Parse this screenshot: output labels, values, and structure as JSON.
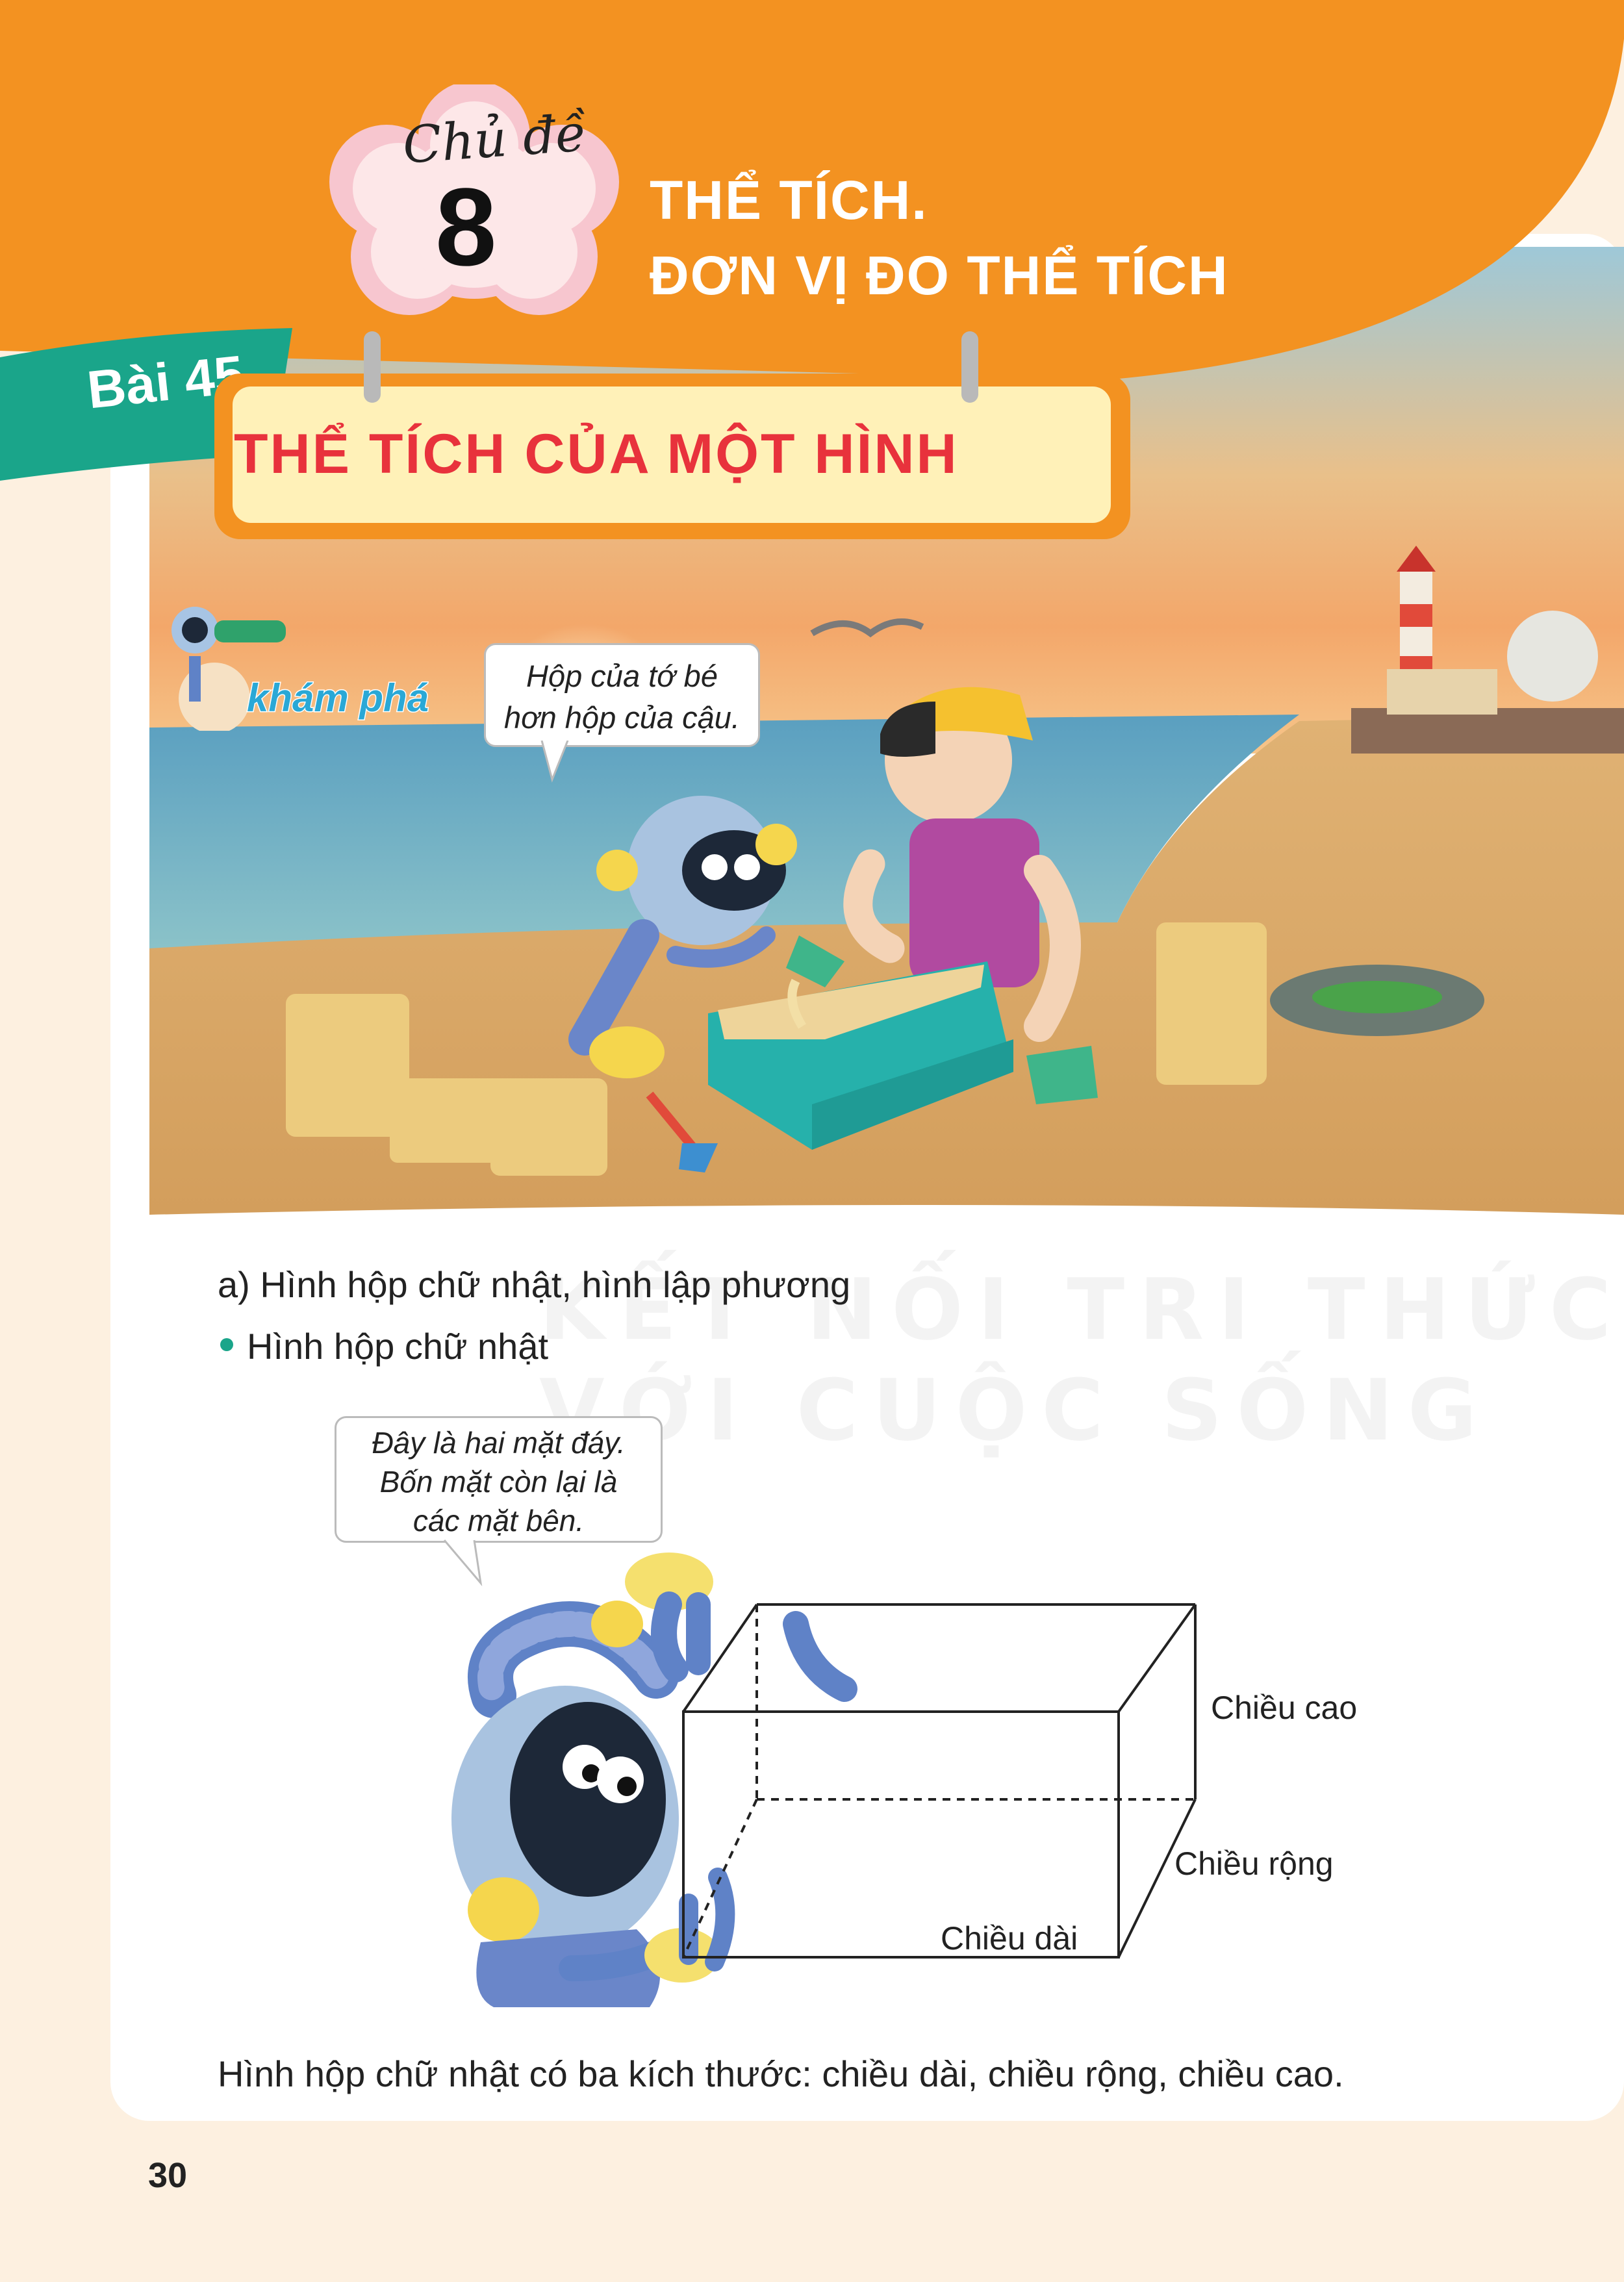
{
  "header": {
    "chapter_label": "Chủ đề",
    "chapter_number": "8",
    "chapter_title_line1": "THỂ TÍCH.",
    "chapter_title_line2": "ĐƠN VỊ ĐO THỂ TÍCH",
    "lesson_number": "Bài 45",
    "lesson_title": "THỂ TÍCH CỦA MỘT HÌNH"
  },
  "illustration": {
    "section_tag": "khám phá",
    "speech_line1": "Hộp của tớ bé",
    "speech_line2": "hơn hộp của cậu."
  },
  "content": {
    "subheading": "a) Hình hộp chữ nhật, hình lập phương",
    "bullet": "Hình hộp chữ nhật",
    "robot_speech_line1": "Đây là hai mặt đáy.",
    "robot_speech_line2": "Bốn mặt còn lại là",
    "robot_speech_line3": "các mặt bên.",
    "label_height": "Chiều cao",
    "label_width": "Chiều rộng",
    "label_length": "Chiều dài",
    "conclusion": "Hình hộp chữ nhật có ba kích thước: chiều dài, chiều rộng, chiều cao."
  },
  "watermark": {
    "line1": "KẾT NỐI TRI THỨC",
    "line2": "VỚI CUỘC SỐNG"
  },
  "page_number": "30",
  "colors": {
    "orange": "#f39221",
    "teal": "#1aa58a",
    "title_red": "#e8323c",
    "page_cream": "#fdf0e0",
    "box_teal": "#25b5b0"
  }
}
